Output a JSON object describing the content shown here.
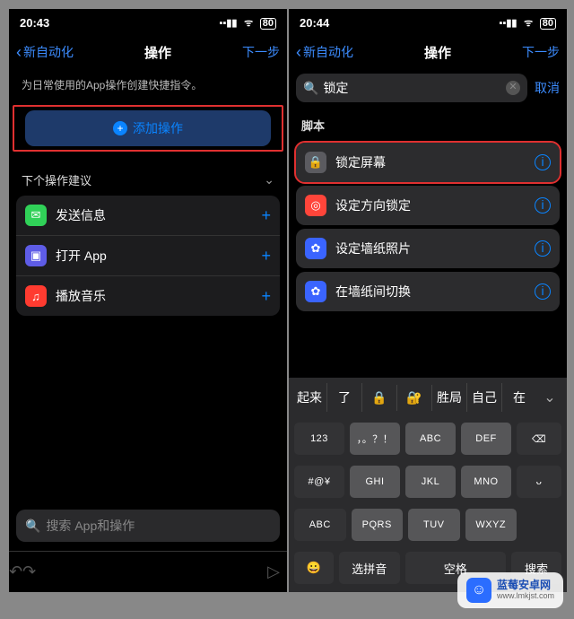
{
  "left": {
    "status": {
      "time": "20:43",
      "battery": "80"
    },
    "nav": {
      "back": "新自动化",
      "title": "操作",
      "next": "下一步"
    },
    "subtitle": "为日常使用的App操作创建快捷指令。",
    "add_button": "添加操作",
    "suggest_header": "下个操作建议",
    "suggestions": [
      {
        "icon_bg": "#30d158",
        "glyph": "✉︎",
        "label": "发送信息"
      },
      {
        "icon_bg": "#5e5ce6",
        "glyph": "▣",
        "label": "打开 App"
      },
      {
        "icon_bg": "#ff3b30",
        "glyph": "♫",
        "label": "播放音乐"
      }
    ],
    "search_placeholder": "搜索 App和操作"
  },
  "right": {
    "status": {
      "time": "20:44",
      "battery": "80"
    },
    "nav": {
      "back": "新自动化",
      "title": "操作",
      "next": "下一步"
    },
    "search": {
      "value": "锁定",
      "cancel": "取消"
    },
    "section": "脚本",
    "results": [
      {
        "icon_bg": "#5b5b60",
        "glyph": "🔒",
        "label": "锁定屏幕",
        "hl": true
      },
      {
        "icon_bg": "#ff453a",
        "glyph": "◎",
        "label": "设定方向锁定"
      },
      {
        "icon_bg": "#3a64ff",
        "glyph": "✿",
        "label": "设定墙纸照片"
      },
      {
        "icon_bg": "#3a64ff",
        "glyph": "✿",
        "label": "在墙纸间切换"
      }
    ],
    "keyboard": {
      "candidates": [
        "起来",
        "了",
        "🔒",
        "🔐",
        "胜局",
        "自己",
        "在"
      ],
      "row1": [
        "123",
        "，。？！",
        "ABC",
        "DEF"
      ],
      "row2": [
        "#@¥",
        "GHI",
        "JKL",
        "MNO"
      ],
      "row3": [
        "ABC",
        "PQRS",
        "TUV",
        "WXYZ"
      ],
      "bottom": {
        "emoji": "😀",
        "pinyin": "选拼音",
        "space": "空格",
        "search": "搜索"
      },
      "delete": "⌫",
      "voice": "ᴗ"
    }
  },
  "watermark": {
    "title": "蓝莓安卓网",
    "url": "www.lmkjst.com"
  }
}
